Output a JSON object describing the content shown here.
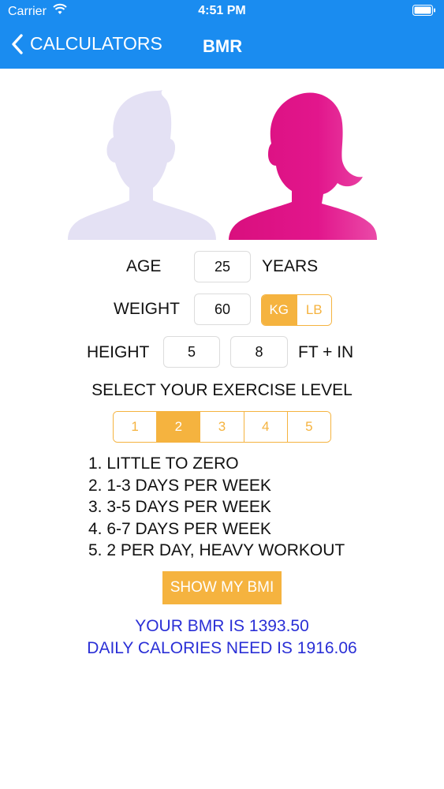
{
  "status": {
    "carrier": "Carrier",
    "time": "4:51 PM"
  },
  "nav": {
    "back_label": "CALCULATORS",
    "title": "BMR"
  },
  "colors": {
    "nav_bg": "#1a8cf0",
    "accent": "#f5b33f",
    "female": "#e2168c",
    "male": "#e4e1f4",
    "result_text": "#2a2fd6"
  },
  "form": {
    "age_label": "AGE",
    "age_value": "25",
    "age_unit": "YEARS",
    "weight_label": "WEIGHT",
    "weight_value": "60",
    "weight_units": [
      "KG",
      "LB"
    ],
    "weight_unit_selected": "KG",
    "height_label": "HEIGHT",
    "height_ft": "5",
    "height_in": "8",
    "height_unit": "FT + IN",
    "exercise_title": "SELECT YOUR EXERCISE LEVEL",
    "levels": [
      "1",
      "2",
      "3",
      "4",
      "5"
    ],
    "level_selected": "2",
    "level_descriptions": [
      "1. LITTLE TO ZERO",
      "2. 1-3 DAYS PER WEEK",
      "3. 3-5 DAYS PER WEEK",
      "4. 6-7 DAYS PER WEEK",
      "5. 2 PER DAY, HEAVY WORKOUT"
    ],
    "button_label": "SHOW MY BMI"
  },
  "results": {
    "bmr": "YOUR BMR IS 1393.50",
    "calories": "DAILY CALORIES NEED IS 1916.06"
  }
}
